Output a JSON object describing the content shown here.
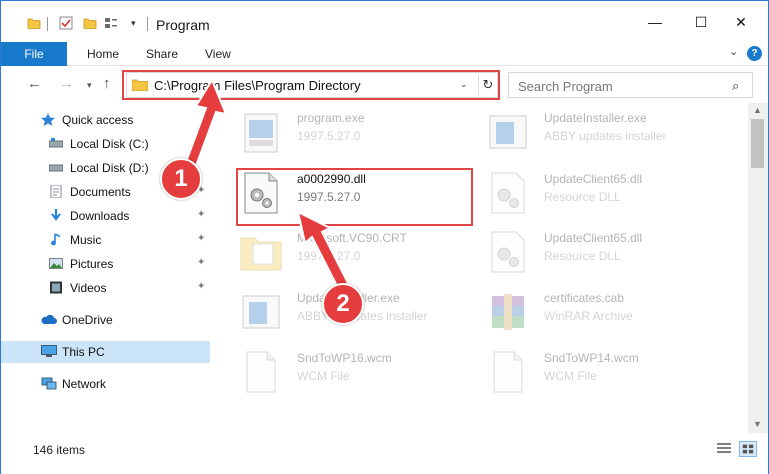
{
  "window": {
    "title": "Program",
    "min_glyph": "—",
    "max_glyph": "☐",
    "close_glyph": "✕"
  },
  "ribbon": {
    "tabs": [
      "File",
      "Home",
      "Share",
      "View"
    ],
    "help": "?",
    "collapse": "⌄"
  },
  "nav": {
    "back": "←",
    "forward": "→",
    "recent": "▾",
    "up": "↑"
  },
  "address": {
    "path": "C:\\Program Files\\Program Directory",
    "dropdown": "⌄",
    "refresh": "↻"
  },
  "search": {
    "placeholder": "Search Program",
    "icon": "⌕"
  },
  "sidebar": {
    "items": [
      {
        "label": "Quick access",
        "icon": "star-icon",
        "pinned": false
      },
      {
        "label": "Local Disk (C:)",
        "icon": "drive-icon",
        "pinned": false
      },
      {
        "label": "Local Disk (D:)",
        "icon": "drive-icon",
        "pinned": false
      },
      {
        "label": "Documents",
        "icon": "documents-icon",
        "pinned": true
      },
      {
        "label": "Downloads",
        "icon": "download-icon",
        "pinned": true
      },
      {
        "label": "Music",
        "icon": "music-icon",
        "pinned": true
      },
      {
        "label": "Pictures",
        "icon": "pictures-icon",
        "pinned": true
      },
      {
        "label": "Videos",
        "icon": "videos-icon",
        "pinned": true
      },
      {
        "label": "OneDrive",
        "icon": "cloud-icon",
        "pinned": false
      },
      {
        "label": "This PC",
        "icon": "computer-icon",
        "pinned": false,
        "selected": true
      },
      {
        "label": "Network",
        "icon": "network-icon",
        "pinned": false
      }
    ],
    "pin_glyph": "📌"
  },
  "files": [
    {
      "name": "program.exe",
      "detail": "1997.5.27.0",
      "icon": "exe-icon",
      "faded": true
    },
    {
      "name": "UpdateInstaller.exe",
      "detail": "ABBY updates installer",
      "icon": "exe-icon",
      "faded": true
    },
    {
      "name": "a0002990.dll",
      "detail": "1997.5.27.0",
      "icon": "dll-gear-icon",
      "faded": false
    },
    {
      "name": "UpdateClient65.dll",
      "detail": "Resource DLL",
      "icon": "dll-gear-icon",
      "faded": true
    },
    {
      "name": "Microsoft.VC90.CRT",
      "detail": "1997.5.27.0",
      "icon": "folder-icon",
      "faded": true
    },
    {
      "name": "UpdateClient65.dll",
      "detail": "Resource DLL",
      "icon": "dll-gear-icon",
      "faded": true
    },
    {
      "name": "UpdateInstaller.exe",
      "detail": "ABBYY updates installer",
      "icon": "exe-icon",
      "faded": true
    },
    {
      "name": "certificates.cab",
      "detail": "WinRAR Archive",
      "icon": "archive-icon",
      "faded": true
    },
    {
      "name": "SndToWP16.wcm",
      "detail": "WCM File",
      "icon": "blank-file-icon",
      "faded": true
    },
    {
      "name": "SndToWP14.wcm",
      "detail": "WCM File",
      "icon": "blank-file-icon",
      "faded": true
    }
  ],
  "status": {
    "count": "146 items"
  },
  "annotations": {
    "step1": "1",
    "step2": "2",
    "color": "#e53d3d"
  },
  "colors": {
    "accent": "#1979ca",
    "selection": "#cce4f7",
    "highlight_border": "#e04545"
  }
}
